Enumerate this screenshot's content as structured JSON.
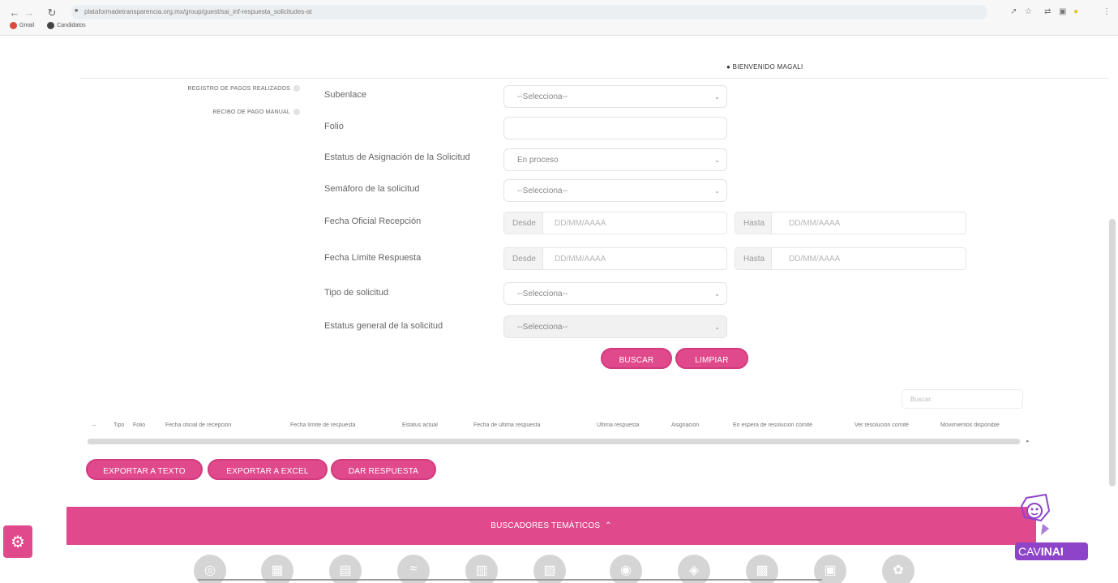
{
  "browser": {
    "url": "plataformadetransparencia.org.mx/group/guest/sai_inf-respuesta_solicitudes-at",
    "bookmarks": [
      "Gmail",
      "Candidatos"
    ]
  },
  "header": {
    "welcome": "BIENVENIDO MAGALI"
  },
  "sidebar": {
    "items": [
      {
        "label": "REGISTRO DE PAGOS REALIZADOS"
      },
      {
        "label": "RECIBO DE PAGO MANUAL"
      }
    ]
  },
  "form": {
    "subenlace": {
      "label": "Subenlace",
      "value": "--Selecciona--"
    },
    "folio": {
      "label": "Folio",
      "value": ""
    },
    "estatus_asignacion": {
      "label": "Estatus de Asignación de la Solicitud",
      "value": "En proceso"
    },
    "semaforo": {
      "label": "Semáforo de la solicitud",
      "value": "--Selecciona--"
    },
    "fecha_oficial": {
      "label": "Fecha Oficial Recepción",
      "desde": "Desde",
      "hasta": "Hasta",
      "placeholder": "DD/MM/AAAA"
    },
    "fecha_limite": {
      "label": "Fecha Límite Respuesta",
      "desde": "Desde",
      "hasta": "Hasta",
      "placeholder": "DD/MM/AAAA"
    },
    "tipo_solicitud": {
      "label": "Tipo de solicitud",
      "value": "--Selecciona--"
    },
    "estatus_general": {
      "label": "Estatus general de la solicitud",
      "value": "--Selecciona--"
    },
    "buscar": "BUSCAR",
    "limpiar": "LIMPIAR"
  },
  "table": {
    "search_placeholder": "Buscar:",
    "columns": [
      "Tipo",
      "Folio",
      "Fecha oficial de recepción",
      "Fecha límite de respuesta",
      "Estatus actual",
      "Fecha de última respuesta",
      "Última respuesta",
      "Asignación",
      "En espera de resolución comité",
      "Ver resolución comité",
      "Movimientos disponible"
    ]
  },
  "actions": {
    "exportar_texto": "EXPORTAR A TEXTO",
    "exportar_excel": "EXPORTAR A EXCEL",
    "dar_respuesta": "DAR RESPUESTA"
  },
  "footer": {
    "banner": "BUSCADORES TEMÁTICOS",
    "theme_icons": [
      "theme-icon-1",
      "theme-icon-2",
      "theme-icon-3",
      "theme-icon-4",
      "theme-icon-5",
      "theme-icon-6",
      "theme-icon-7",
      "theme-icon-8",
      "theme-icon-9",
      "theme-icon-10",
      "theme-icon-11",
      "theme-icon-12"
    ],
    "cav_logo": {
      "prefix": "CAV",
      "suffix": "INAI"
    }
  },
  "colors": {
    "accent": "#e04a8c",
    "cav": "#8e44c9"
  }
}
